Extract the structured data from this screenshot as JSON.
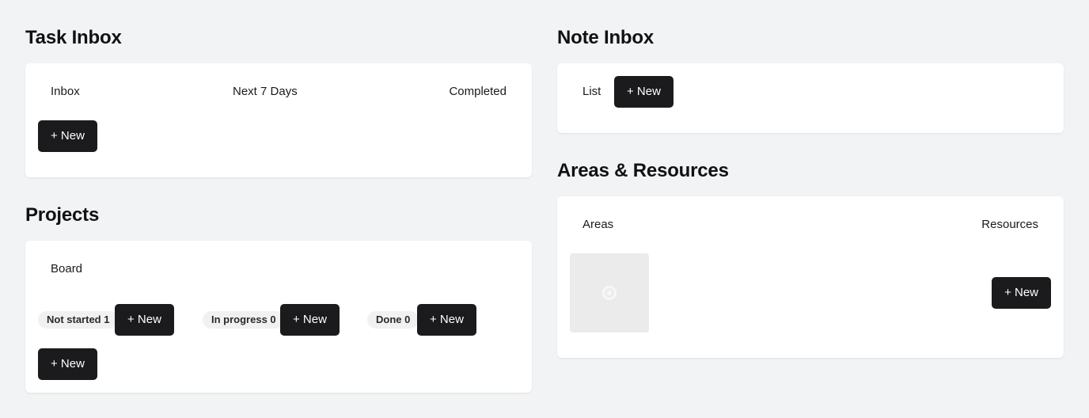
{
  "task_inbox": {
    "title": "Task Inbox",
    "tabs": [
      "Inbox",
      "Next 7 Days",
      "Completed"
    ],
    "new_label": "+ New"
  },
  "projects": {
    "title": "Projects",
    "tab": "Board",
    "columns": [
      {
        "label": "Not started 1",
        "new_label": "+ New"
      },
      {
        "label": "In progress 0",
        "new_label": "+ New"
      },
      {
        "label": "Done 0",
        "new_label": "+ New"
      }
    ],
    "new_label": "+ New"
  },
  "note_inbox": {
    "title": "Note Inbox",
    "tab": "List",
    "new_label": "+ New"
  },
  "areas_resources": {
    "title": "Areas & Resources",
    "tabs": [
      "Areas",
      "Resources"
    ],
    "new_label": "+ New"
  }
}
